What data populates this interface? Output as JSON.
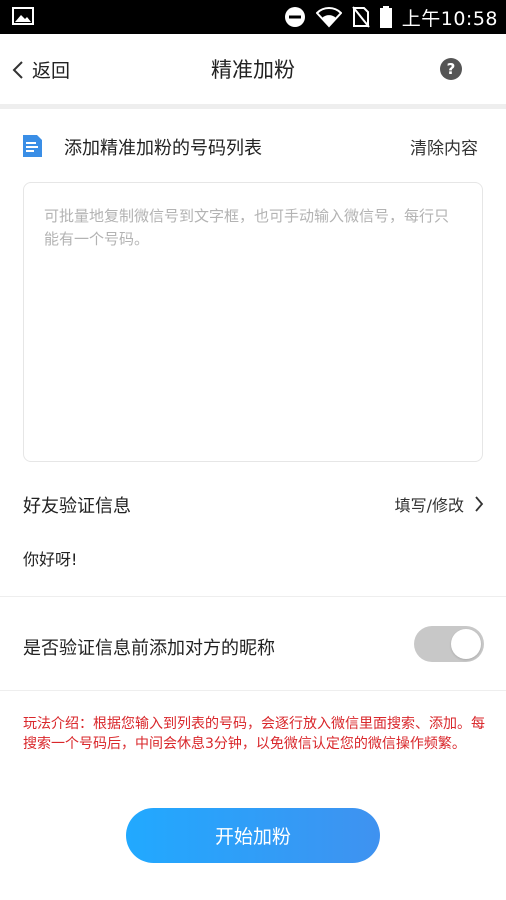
{
  "status_bar": {
    "time": "上午10:58",
    "icons": [
      "image-icon",
      "do-not-disturb-icon",
      "wifi-icon",
      "no-sim-icon",
      "battery-icon"
    ]
  },
  "nav": {
    "back_label": "返回",
    "title": "精准加粉",
    "help_label": "?"
  },
  "number_list": {
    "title": "添加精准加粉的号码列表",
    "clear_label": "清除内容",
    "input_value": "",
    "placeholder": "可批量地复制微信号到文字框，也可手动输入微信号，每行只能有一个号码。"
  },
  "verify": {
    "label": "好友验证信息",
    "edit_label": "填写/修改",
    "message": "你好呀!"
  },
  "nickname_option": {
    "label": "是否验证信息前添加对方的昵称",
    "enabled": false
  },
  "intro_text": "玩法介绍：根据您输入到列表的号码，会逐行放入微信里面搜索、添加。每搜索一个号码后，中间会休息3分钟，以免微信认定您的微信操作频繁。",
  "start_button_label": "开始加粉",
  "colors": {
    "accent_blue": "#2aa5ff",
    "intro_red": "#d9272b",
    "toggle_off": "#c8c8c8",
    "doc_icon_blue": "#3a8ee6"
  }
}
